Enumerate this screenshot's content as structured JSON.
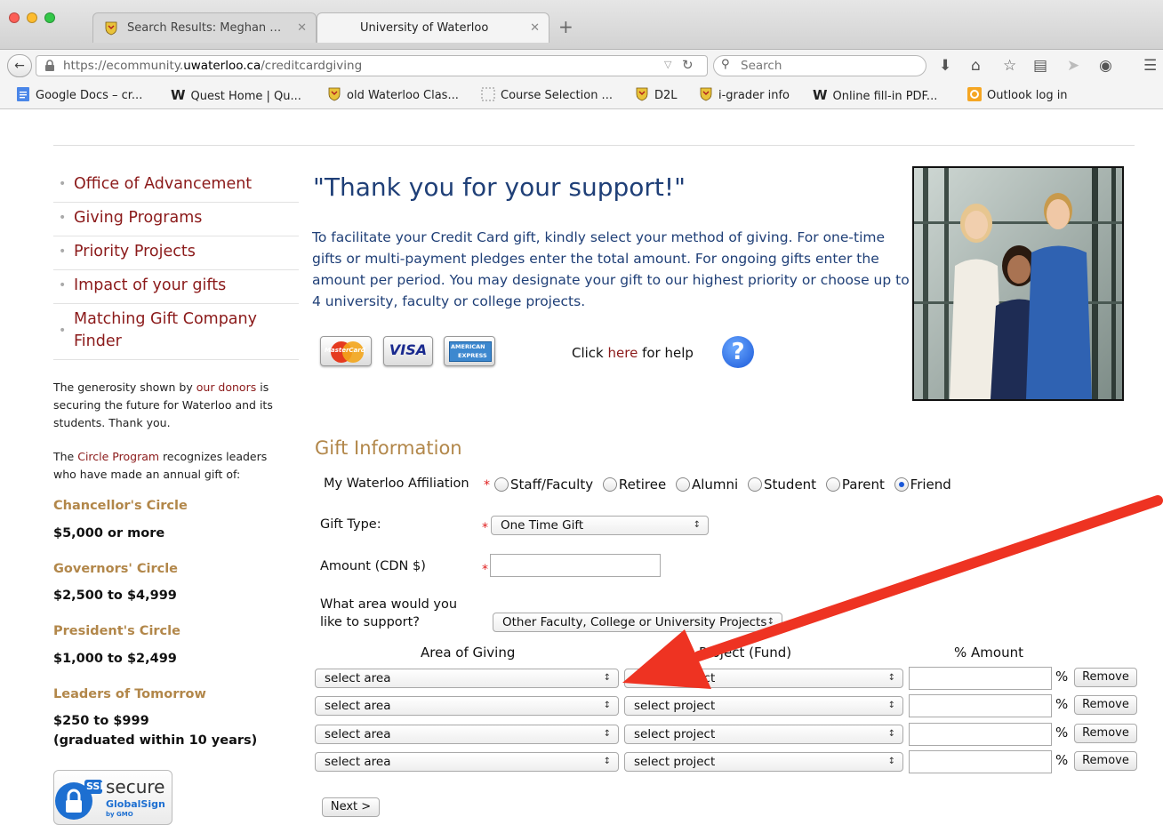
{
  "browser": {
    "tabs": [
      {
        "title": "Search Results: Meghan W...",
        "close": "✕"
      },
      {
        "title": "University of Waterloo",
        "close": "✕"
      }
    ],
    "new_tab": "+",
    "url_scheme": "https://ecommunity.",
    "url_domain": "uwaterloo.ca",
    "url_path": "/creditcardgiving",
    "search_placeholder": "Search",
    "bookmarks": [
      {
        "label": "Google Docs – cr..."
      },
      {
        "label": "Quest Home | Qu..."
      },
      {
        "label": "old Waterloo Clas..."
      },
      {
        "label": "Course Selection ..."
      },
      {
        "label": "D2L"
      },
      {
        "label": "i-grader info"
      },
      {
        "label": "Online fill-in PDF..."
      },
      {
        "label": "Outlook log in"
      }
    ]
  },
  "sidebar": {
    "nav": [
      {
        "label": "Office of Advancement"
      },
      {
        "label": "Giving Programs"
      },
      {
        "label": "Priority Projects"
      },
      {
        "label": "Impact of your gifts"
      },
      {
        "label": "Matching Gift Company Finder"
      }
    ],
    "donors_pre": "The generosity shown by ",
    "donors_link": "our donors",
    "donors_post": " is securing the future for Waterloo and its students. Thank you.",
    "circle_pre": "The ",
    "circle_link": "Circle Program",
    "circle_post": " recognizes leaders who have made an annual gift of:",
    "circles": [
      {
        "name": "Chancellor's Circle",
        "amount": "$5,000 or more"
      },
      {
        "name": "Governors' Circle",
        "amount": "$2,500 to $4,999"
      },
      {
        "name": "President's Circle",
        "amount": "$1,000 to $2,499"
      },
      {
        "name": "Leaders of Tomorrow",
        "amount": "$250 to $999",
        "note": "(graduated within 10 years)"
      }
    ],
    "ssl": {
      "tag": "SSL",
      "secure": "secure",
      "brand": "GlobalSign",
      "by": "by GMO"
    }
  },
  "main": {
    "title": "\"Thank you for your support!\"",
    "intro": "To facilitate your Credit Card gift, kindly select your method of giving. For one-time gifts or multi-payment pledges enter the total amount. For ongoing gifts enter the amount per period. You may designate your gift to our highest priority or choose up to 4 university, faculty or college projects.",
    "cards": {
      "mastercard": "MasterCard",
      "visa": "VISA",
      "amex_top": "AMERICAN",
      "amex_bottom": "EXPRESS"
    },
    "help_pre": "Click ",
    "help_link": "here",
    "help_post": " for help",
    "help_icon": "?"
  },
  "form": {
    "section_title": "Gift Information",
    "affiliation_label": "My Waterloo Affiliation",
    "affiliation_options": [
      "Staff/Faculty",
      "Retiree",
      "Alumni",
      "Student",
      "Parent",
      "Friend"
    ],
    "affiliation_selected": "Friend",
    "gift_type_label": "Gift Type:",
    "gift_type_value": "One Time Gift",
    "amount_label": "Amount (CDN $)",
    "amount_value": "",
    "area_label_1": "What area would you",
    "area_label_2": "like to support?",
    "area_value": "Other Faculty, College or University Projects",
    "columns": {
      "area": "Area of Giving",
      "project": "Project (Fund)",
      "amount": "% Amount"
    },
    "rows": [
      {
        "area": "select area",
        "project": "select project",
        "pct_sign": "%",
        "remove": "Remove"
      },
      {
        "area": "select area",
        "project": "select project",
        "pct_sign": "%",
        "remove": "Remove"
      },
      {
        "area": "select area",
        "project": "select project",
        "pct_sign": "%",
        "remove": "Remove"
      },
      {
        "area": "select area",
        "project": "select project",
        "pct_sign": "%",
        "remove": "Remove"
      }
    ],
    "next_label": "Next >"
  },
  "colors": {
    "nav_link": "#8b1a1a",
    "title_blue": "#1f3f77",
    "gold": "#b2874a",
    "annotation_arrow": "#ee3322",
    "required": "#e02020"
  }
}
